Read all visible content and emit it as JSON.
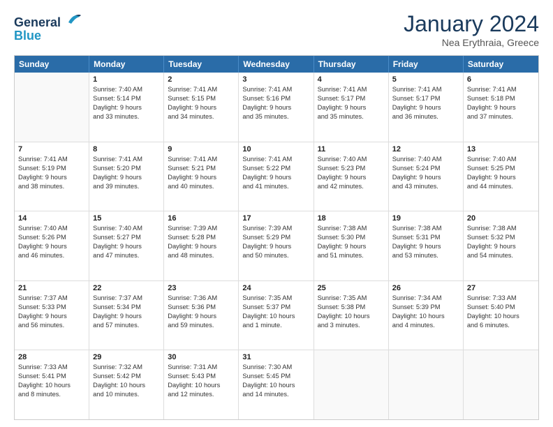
{
  "header": {
    "logo_line1": "General",
    "logo_line2": "Blue",
    "month_title": "January 2024",
    "subtitle": "Nea Erythraia, Greece"
  },
  "weekdays": [
    "Sunday",
    "Monday",
    "Tuesday",
    "Wednesday",
    "Thursday",
    "Friday",
    "Saturday"
  ],
  "rows": [
    [
      {
        "day": "",
        "lines": []
      },
      {
        "day": "1",
        "lines": [
          "Sunrise: 7:40 AM",
          "Sunset: 5:14 PM",
          "Daylight: 9 hours",
          "and 33 minutes."
        ]
      },
      {
        "day": "2",
        "lines": [
          "Sunrise: 7:41 AM",
          "Sunset: 5:15 PM",
          "Daylight: 9 hours",
          "and 34 minutes."
        ]
      },
      {
        "day": "3",
        "lines": [
          "Sunrise: 7:41 AM",
          "Sunset: 5:16 PM",
          "Daylight: 9 hours",
          "and 35 minutes."
        ]
      },
      {
        "day": "4",
        "lines": [
          "Sunrise: 7:41 AM",
          "Sunset: 5:17 PM",
          "Daylight: 9 hours",
          "and 35 minutes."
        ]
      },
      {
        "day": "5",
        "lines": [
          "Sunrise: 7:41 AM",
          "Sunset: 5:17 PM",
          "Daylight: 9 hours",
          "and 36 minutes."
        ]
      },
      {
        "day": "6",
        "lines": [
          "Sunrise: 7:41 AM",
          "Sunset: 5:18 PM",
          "Daylight: 9 hours",
          "and 37 minutes."
        ]
      }
    ],
    [
      {
        "day": "7",
        "lines": [
          "Sunrise: 7:41 AM",
          "Sunset: 5:19 PM",
          "Daylight: 9 hours",
          "and 38 minutes."
        ]
      },
      {
        "day": "8",
        "lines": [
          "Sunrise: 7:41 AM",
          "Sunset: 5:20 PM",
          "Daylight: 9 hours",
          "and 39 minutes."
        ]
      },
      {
        "day": "9",
        "lines": [
          "Sunrise: 7:41 AM",
          "Sunset: 5:21 PM",
          "Daylight: 9 hours",
          "and 40 minutes."
        ]
      },
      {
        "day": "10",
        "lines": [
          "Sunrise: 7:41 AM",
          "Sunset: 5:22 PM",
          "Daylight: 9 hours",
          "and 41 minutes."
        ]
      },
      {
        "day": "11",
        "lines": [
          "Sunrise: 7:40 AM",
          "Sunset: 5:23 PM",
          "Daylight: 9 hours",
          "and 42 minutes."
        ]
      },
      {
        "day": "12",
        "lines": [
          "Sunrise: 7:40 AM",
          "Sunset: 5:24 PM",
          "Daylight: 9 hours",
          "and 43 minutes."
        ]
      },
      {
        "day": "13",
        "lines": [
          "Sunrise: 7:40 AM",
          "Sunset: 5:25 PM",
          "Daylight: 9 hours",
          "and 44 minutes."
        ]
      }
    ],
    [
      {
        "day": "14",
        "lines": [
          "Sunrise: 7:40 AM",
          "Sunset: 5:26 PM",
          "Daylight: 9 hours",
          "and 46 minutes."
        ]
      },
      {
        "day": "15",
        "lines": [
          "Sunrise: 7:40 AM",
          "Sunset: 5:27 PM",
          "Daylight: 9 hours",
          "and 47 minutes."
        ]
      },
      {
        "day": "16",
        "lines": [
          "Sunrise: 7:39 AM",
          "Sunset: 5:28 PM",
          "Daylight: 9 hours",
          "and 48 minutes."
        ]
      },
      {
        "day": "17",
        "lines": [
          "Sunrise: 7:39 AM",
          "Sunset: 5:29 PM",
          "Daylight: 9 hours",
          "and 50 minutes."
        ]
      },
      {
        "day": "18",
        "lines": [
          "Sunrise: 7:38 AM",
          "Sunset: 5:30 PM",
          "Daylight: 9 hours",
          "and 51 minutes."
        ]
      },
      {
        "day": "19",
        "lines": [
          "Sunrise: 7:38 AM",
          "Sunset: 5:31 PM",
          "Daylight: 9 hours",
          "and 53 minutes."
        ]
      },
      {
        "day": "20",
        "lines": [
          "Sunrise: 7:38 AM",
          "Sunset: 5:32 PM",
          "Daylight: 9 hours",
          "and 54 minutes."
        ]
      }
    ],
    [
      {
        "day": "21",
        "lines": [
          "Sunrise: 7:37 AM",
          "Sunset: 5:33 PM",
          "Daylight: 9 hours",
          "and 56 minutes."
        ]
      },
      {
        "day": "22",
        "lines": [
          "Sunrise: 7:37 AM",
          "Sunset: 5:34 PM",
          "Daylight: 9 hours",
          "and 57 minutes."
        ]
      },
      {
        "day": "23",
        "lines": [
          "Sunrise: 7:36 AM",
          "Sunset: 5:36 PM",
          "Daylight: 9 hours",
          "and 59 minutes."
        ]
      },
      {
        "day": "24",
        "lines": [
          "Sunrise: 7:35 AM",
          "Sunset: 5:37 PM",
          "Daylight: 10 hours",
          "and 1 minute."
        ]
      },
      {
        "day": "25",
        "lines": [
          "Sunrise: 7:35 AM",
          "Sunset: 5:38 PM",
          "Daylight: 10 hours",
          "and 3 minutes."
        ]
      },
      {
        "day": "26",
        "lines": [
          "Sunrise: 7:34 AM",
          "Sunset: 5:39 PM",
          "Daylight: 10 hours",
          "and 4 minutes."
        ]
      },
      {
        "day": "27",
        "lines": [
          "Sunrise: 7:33 AM",
          "Sunset: 5:40 PM",
          "Daylight: 10 hours",
          "and 6 minutes."
        ]
      }
    ],
    [
      {
        "day": "28",
        "lines": [
          "Sunrise: 7:33 AM",
          "Sunset: 5:41 PM",
          "Daylight: 10 hours",
          "and 8 minutes."
        ]
      },
      {
        "day": "29",
        "lines": [
          "Sunrise: 7:32 AM",
          "Sunset: 5:42 PM",
          "Daylight: 10 hours",
          "and 10 minutes."
        ]
      },
      {
        "day": "30",
        "lines": [
          "Sunrise: 7:31 AM",
          "Sunset: 5:43 PM",
          "Daylight: 10 hours",
          "and 12 minutes."
        ]
      },
      {
        "day": "31",
        "lines": [
          "Sunrise: 7:30 AM",
          "Sunset: 5:45 PM",
          "Daylight: 10 hours",
          "and 14 minutes."
        ]
      },
      {
        "day": "",
        "lines": []
      },
      {
        "day": "",
        "lines": []
      },
      {
        "day": "",
        "lines": []
      }
    ]
  ]
}
